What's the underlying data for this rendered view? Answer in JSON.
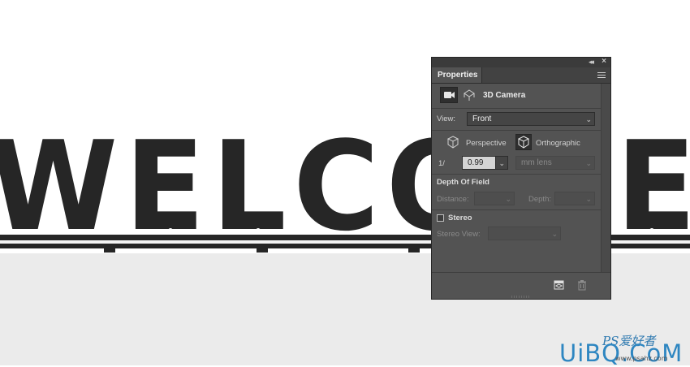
{
  "canvas": {
    "headline": "WELCOME",
    "letter_color": "#262626",
    "floor_color": "#ebebeb"
  },
  "watermark": {
    "brand": "UiBQ.CoM",
    "small_text": "PS爱好者",
    "url": "www.psahz.com"
  },
  "panel": {
    "tab_title": "Properties",
    "section_title": "3D Camera",
    "view": {
      "label": "View:",
      "value": "Front"
    },
    "projection": {
      "perspective_label": "Perspective",
      "orthographic_label": "Orthographic",
      "selected": "Orthographic"
    },
    "zoom": {
      "prefix": "1/",
      "value": "0.99",
      "unit_placeholder": "mm lens"
    },
    "depth_of_field": {
      "title": "Depth Of Field",
      "distance_label": "Distance:",
      "depth_label": "Depth:"
    },
    "stereo": {
      "label": "Stereo",
      "checked": false,
      "view_label": "Stereo View:"
    },
    "icons": {
      "collapse": "double-chevron-left-icon",
      "close": "close-icon",
      "menu": "panel-menu-icon",
      "camera": "video-camera-icon",
      "scene": "3d-scene-icon",
      "perspective": "perspective-cube-icon",
      "orthographic": "orthographic-cube-icon",
      "reset": "reset-view-icon",
      "delete": "trash-icon"
    }
  }
}
